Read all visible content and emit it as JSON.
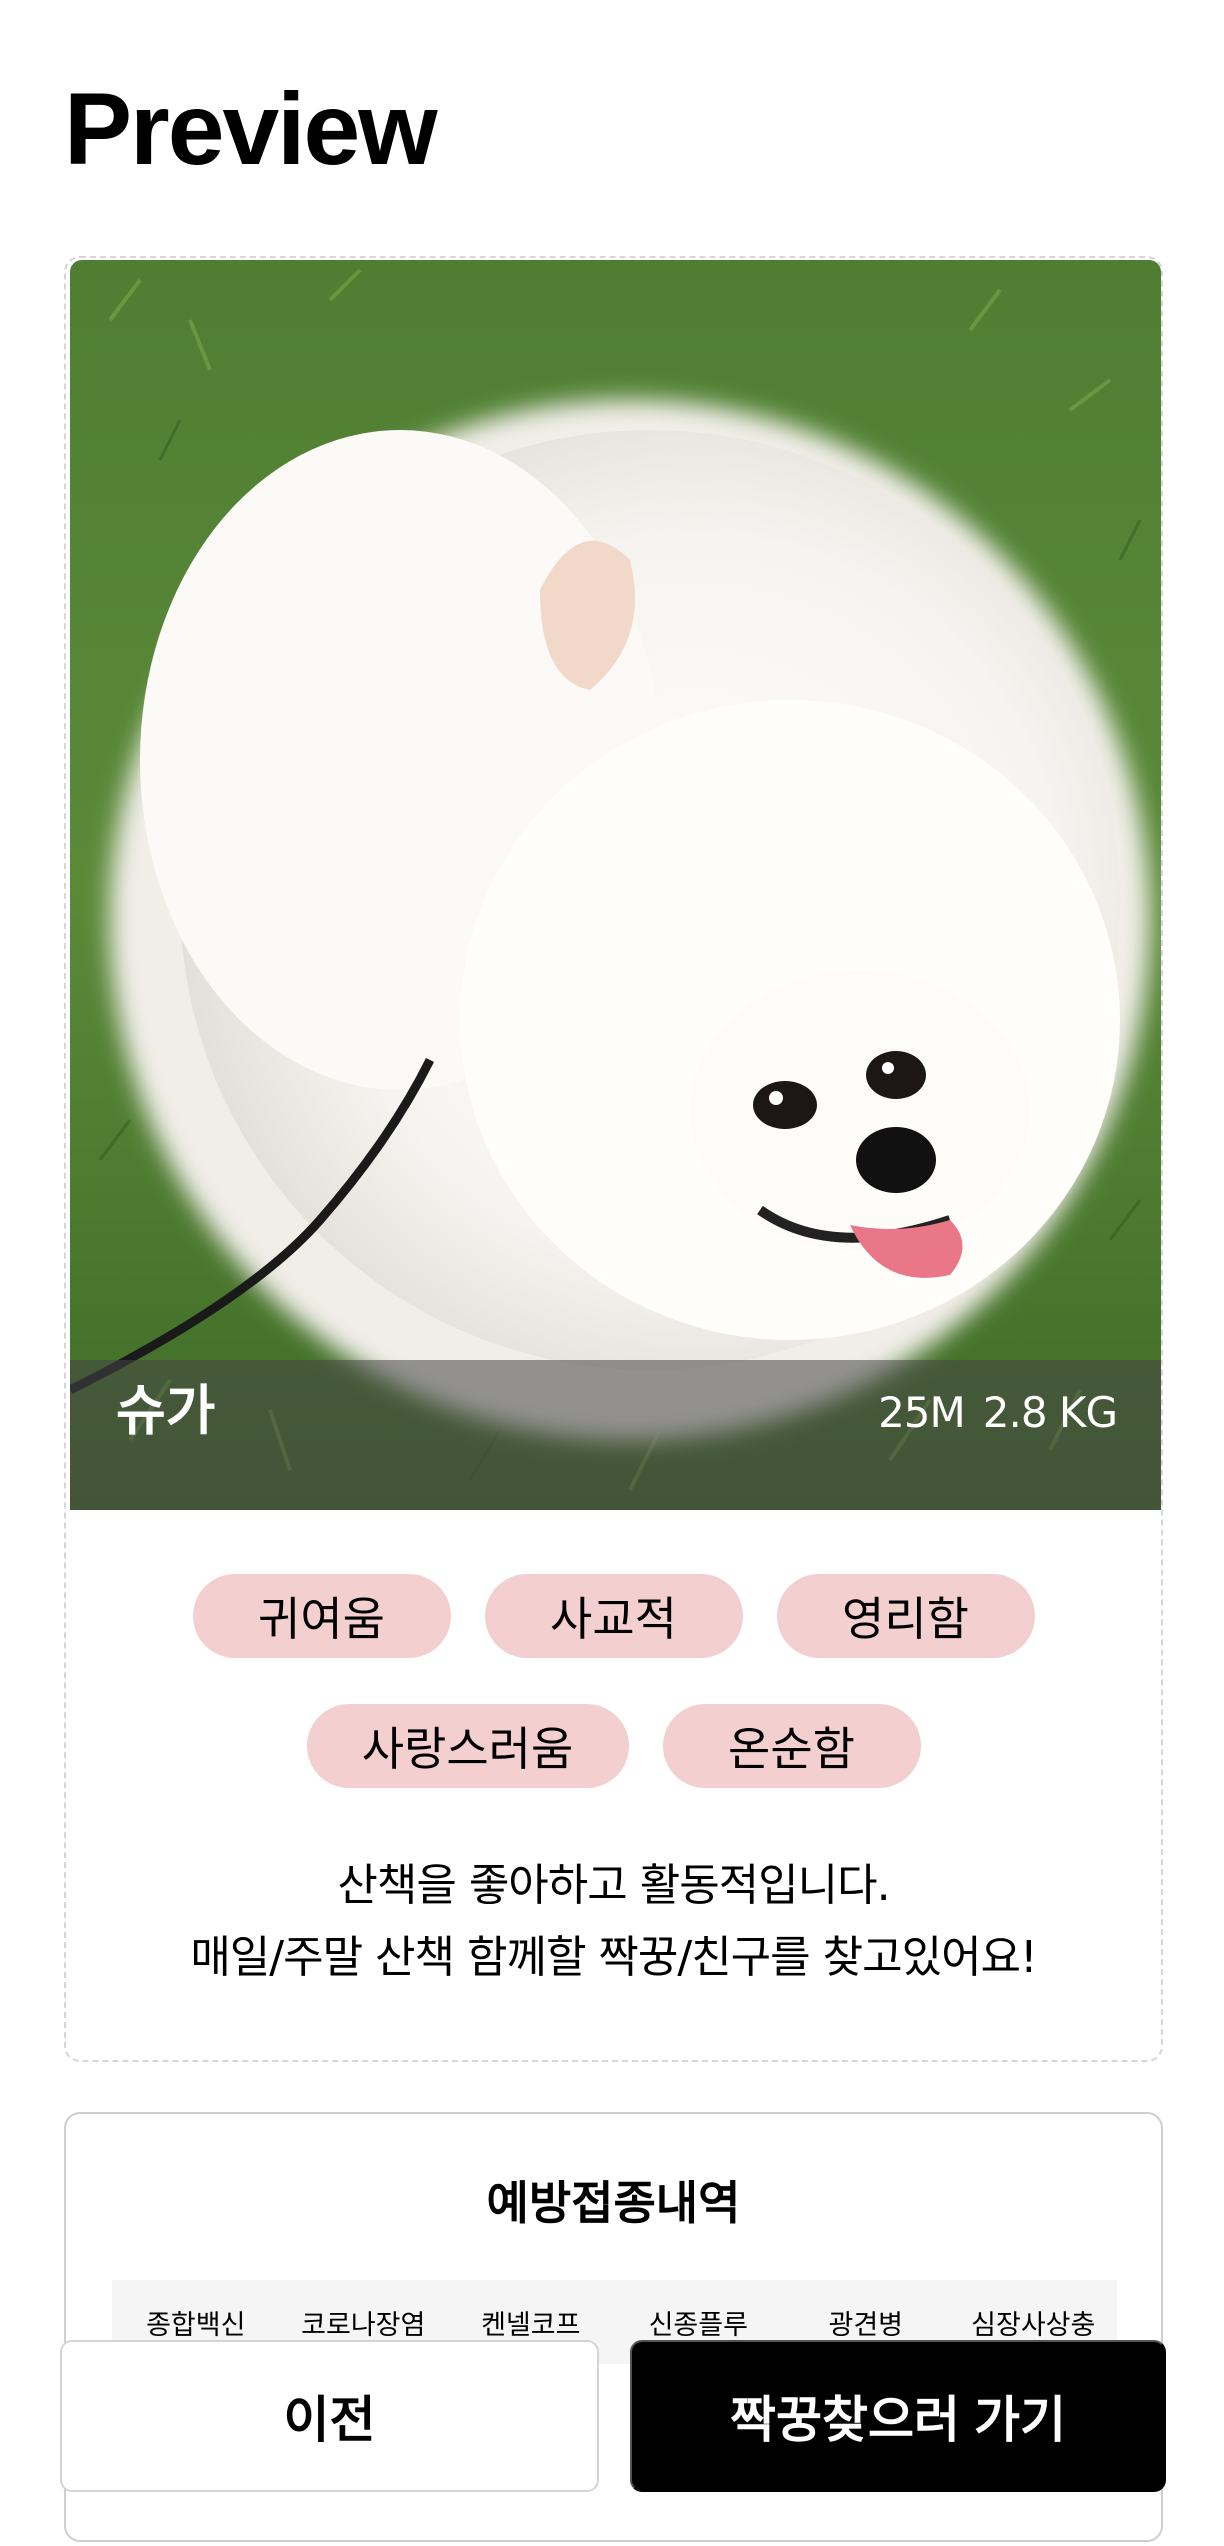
{
  "header": {
    "title": "Preview"
  },
  "profile": {
    "photo_icon": "pomeranian-dog-photo",
    "name": "슈가",
    "age": "25M",
    "weight": "2.8 KG",
    "tags_row1": [
      "귀여움",
      "사교적",
      "영리함"
    ],
    "tags_row2": [
      "사랑스러움",
      "온순함"
    ],
    "description_line1": "산책을 좋아하고 활동적입니다.",
    "description_line2": "매일/주말 산책 함께할 짝꿍/친구를 찾고있어요!"
  },
  "vaccination": {
    "title": "예방접종내역",
    "columns": [
      "종합백신",
      "코로나장염",
      "켄넬코프",
      "신종플루",
      "광견병",
      "심장사상충"
    ]
  },
  "actions": {
    "prev_label": "이전",
    "next_label": "짝꿍찾으러 가기"
  },
  "colors": {
    "tag_background": "#f4cfcf",
    "primary_button": "#000000",
    "secondary_button": "#ffffff"
  }
}
